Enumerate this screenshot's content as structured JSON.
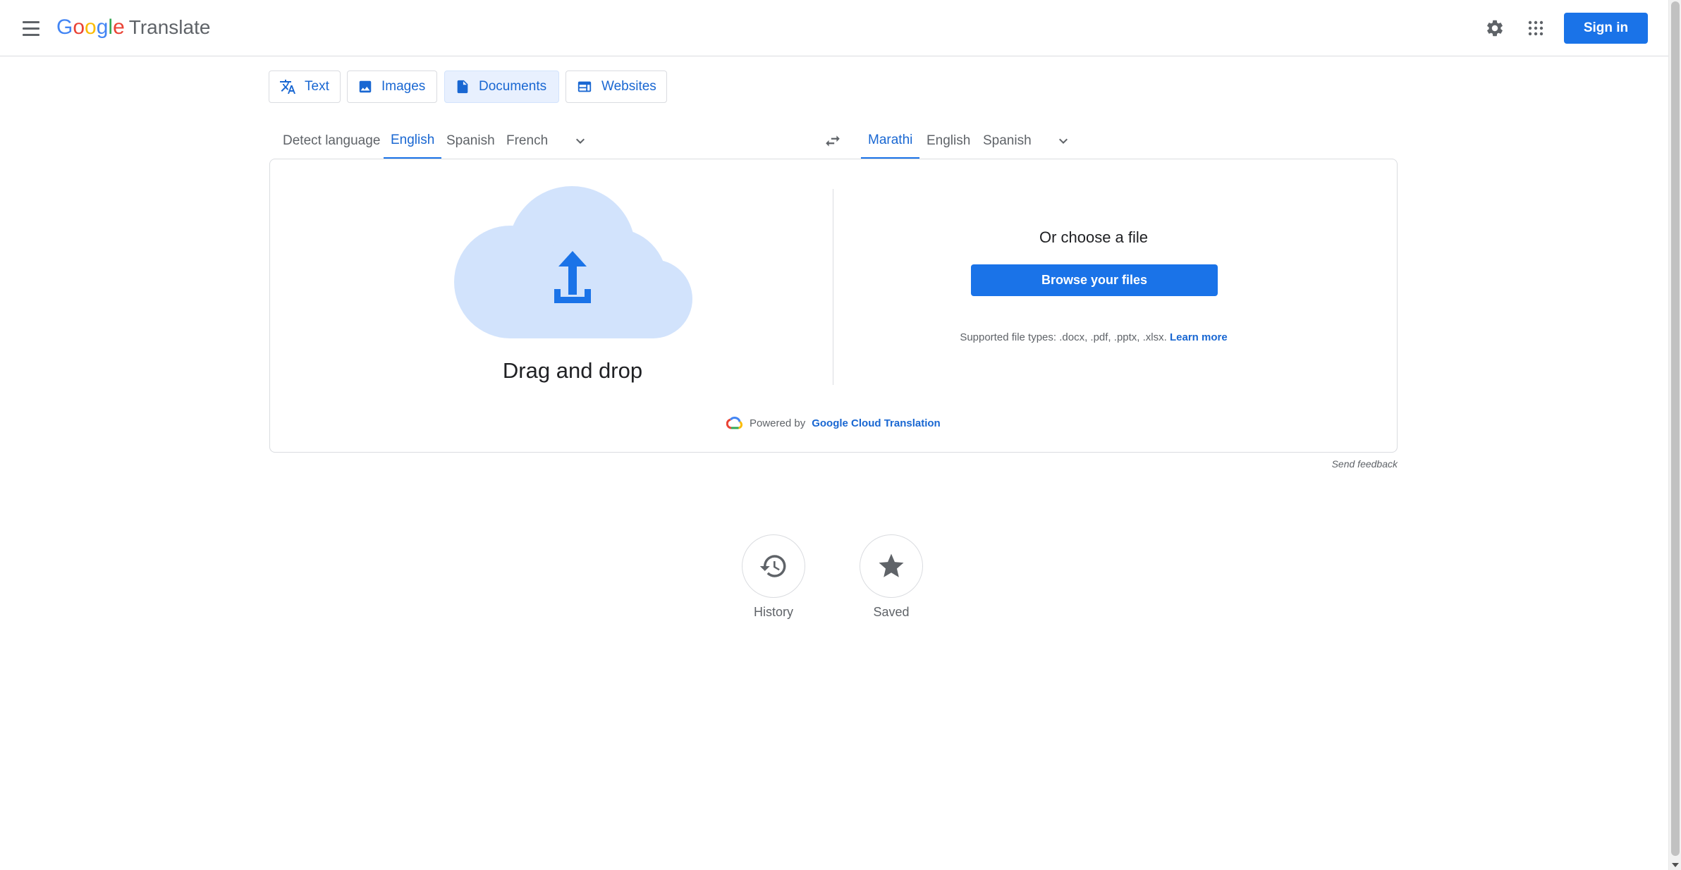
{
  "header": {
    "menu_icon": "hamburger-menu-icon",
    "logo_letters": [
      {
        "ch": "G",
        "color": "#4285f4"
      },
      {
        "ch": "o",
        "color": "#ea4335"
      },
      {
        "ch": "o",
        "color": "#fbbc04"
      },
      {
        "ch": "g",
        "color": "#4285f4"
      },
      {
        "ch": "l",
        "color": "#34a853"
      },
      {
        "ch": "e",
        "color": "#ea4335"
      }
    ],
    "logo_suffix": "Translate",
    "settings_icon": "gear-icon",
    "apps_icon": "apps-grid-icon",
    "sign_in_label": "Sign in"
  },
  "mode_tabs": [
    {
      "label": "Text",
      "icon": "translate-icon",
      "active": false
    },
    {
      "label": "Images",
      "icon": "image-icon",
      "active": false
    },
    {
      "label": "Documents",
      "icon": "document-icon",
      "active": true
    },
    {
      "label": "Websites",
      "icon": "website-icon",
      "active": false
    }
  ],
  "source_languages": {
    "items": [
      {
        "label": "Detect language",
        "active": false
      },
      {
        "label": "English",
        "active": true
      },
      {
        "label": "Spanish",
        "active": false
      },
      {
        "label": "French",
        "active": false
      }
    ],
    "more_icon": "chevron-down-icon"
  },
  "swap_icon": "swap-arrows-icon",
  "target_languages": {
    "items": [
      {
        "label": "Marathi",
        "active": true
      },
      {
        "label": "English",
        "active": false
      },
      {
        "label": "Spanish",
        "active": false
      }
    ],
    "more_icon": "chevron-down-icon"
  },
  "upload": {
    "cloud_icon": "cloud-upload-icon",
    "drag_drop_text": "Drag and drop",
    "choose_text": "Or choose a file",
    "browse_label": "Browse your files",
    "supported_text": "Supported file types: .docx, .pdf, .pptx, .xlsx.",
    "learn_more": "Learn more",
    "powered_by_prefix": "Powered by",
    "powered_by_link": "Google Cloud Translation"
  },
  "send_feedback": "Send feedback",
  "bottom_actions": [
    {
      "label": "History",
      "icon": "history-icon"
    },
    {
      "label": "Saved",
      "icon": "star-icon"
    }
  ],
  "colors": {
    "primary_blue": "#1a73e8",
    "link_blue": "#1967d2",
    "active_tab_bg": "#e8f0fe",
    "cloud_fill": "#d2e3fc",
    "border": "#dadce0"
  }
}
